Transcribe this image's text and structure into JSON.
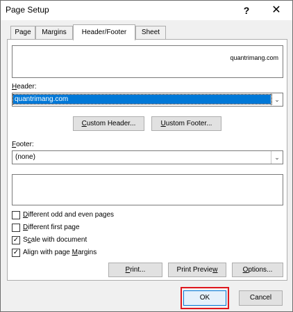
{
  "window": {
    "title": "Page Setup",
    "help_glyph": "?",
    "close_glyph": "✕"
  },
  "tabs": [
    {
      "label": "Page",
      "active": false
    },
    {
      "label": "Margins",
      "active": false
    },
    {
      "label": "Header/Footer",
      "active": true
    },
    {
      "label": "Sheet",
      "active": false
    }
  ],
  "header_preview": {
    "text": "quantrimang.com"
  },
  "header": {
    "label_mnemonic": "H",
    "label_rest": "eader:",
    "selected_value": "quantrimang.com"
  },
  "buttons": {
    "custom_header_mnemonic": "C",
    "custom_header_rest": "ustom Header...",
    "custom_footer_mnemonic": "U",
    "custom_footer_rest": "ustom Footer...",
    "print_mnemonic": "P",
    "print_rest": "rint...",
    "print_preview_a": "Print Previe",
    "print_preview_mnemonic": "w",
    "options_mnemonic": "O",
    "options_rest": "ptions...",
    "ok": "OK",
    "cancel": "Cancel"
  },
  "footer": {
    "label_mnemonic": "F",
    "label_rest": "ooter:",
    "selected_value": "(none)"
  },
  "options": [
    {
      "mnemonic": "D",
      "rest": "ifferent odd and even pages",
      "checked": false
    },
    {
      "mnemonic": "D",
      "rest": "ifferent first page",
      "checked": false
    },
    {
      "mnemonic": "S",
      "rest": "cale with document",
      "checked": true,
      "mnemonic_after": "c",
      "pre": "S",
      "post": "ale with document"
    },
    {
      "mnemonic": "M",
      "pre": "Align with page ",
      "rest": "argins",
      "checked": true
    }
  ],
  "colors": {
    "selection": "#0078d7",
    "highlight": "#e0181e"
  }
}
